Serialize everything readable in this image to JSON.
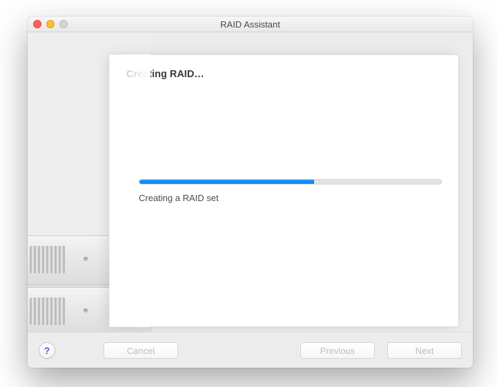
{
  "window": {
    "title": "RAID Assistant"
  },
  "sheet": {
    "heading": "Creating RAID…"
  },
  "progress": {
    "percent": 58,
    "status": "Creating a RAID set"
  },
  "footer": {
    "help_glyph": "?",
    "cancel_label": "Cancel",
    "previous_label": "Previous",
    "next_label": "Next"
  },
  "buttons_state": {
    "cancel_enabled": false,
    "previous_enabled": false,
    "next_enabled": false
  },
  "colors": {
    "accent": "#0a84ff",
    "window_bg": "#ececec"
  }
}
